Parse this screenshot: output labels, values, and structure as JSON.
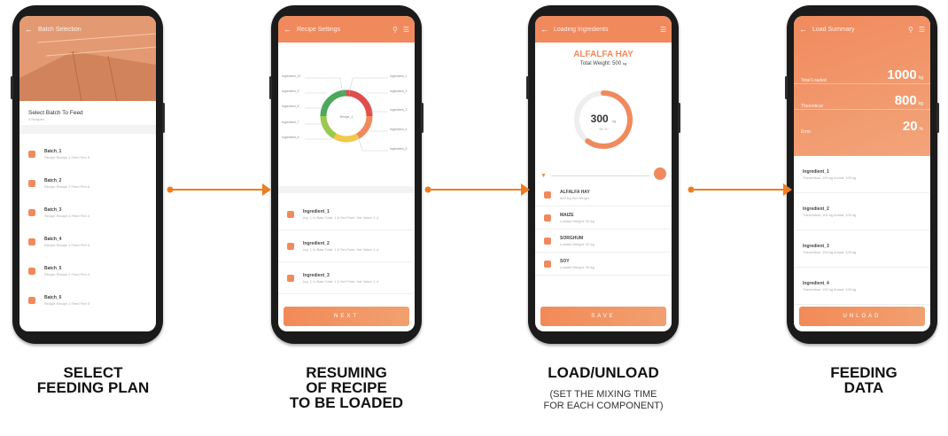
{
  "screens": [
    {
      "title": "Batch Selection",
      "section_title": "Select Batch To Feed",
      "section_sub": "3 Recipes",
      "items": [
        {
          "title": "Batch_1",
          "sub": "Recipe Recipe 1 Feed Pen 9"
        },
        {
          "title": "Batch_2",
          "sub": "Recipe Recipe 2 Feed Pen 8"
        },
        {
          "title": "Batch_3",
          "sub": "Recipe Recipe 3 Feed Pen 4"
        },
        {
          "title": "Batch_4",
          "sub": "Recipe Recipe 1 Feed Pen 4"
        },
        {
          "title": "Batch_5",
          "sub": "Recipe Recipe 2 Feed Pen 3"
        },
        {
          "title": "Batch_6",
          "sub": "Recipe Recipe 1 Feed Pen 5"
        }
      ]
    },
    {
      "title": "Recipe Settings",
      "donut_center": "Recipe_1",
      "donut_labels_left": [
        "Ingredient_10",
        "Ingredient_9",
        "Ingredient_8",
        "Ingredient_7",
        "Ingredient_6"
      ],
      "donut_labels_right": [
        "Ingredient_1",
        "Ingredient_2",
        "Ingredient_3",
        "Ingredient_4",
        "Ingredient_5"
      ],
      "items": [
        {
          "title": "Ingredient_1",
          "sub": "Ing. 1 In Bale Total: 1.6 Set Point: Set Value: 1.4"
        },
        {
          "title": "Ingredient_2",
          "sub": "Ing. 1 In Bale Total: 1.6 Set Point: Set Value: 1.4"
        },
        {
          "title": "Ingredient_3",
          "sub": "Ing. 1 In Bale Total: 1.6 Set Point: Set Value: 1.4"
        }
      ],
      "button": "NEXT"
    },
    {
      "title": "Loading Ingredients",
      "ingredient": "ALFALFA HAY",
      "total_weight_label": "Total Weight:",
      "total_weight_value": "500",
      "total_weight_unit": "kg",
      "gauge_value": "300",
      "gauge_unit": "kg",
      "gauge_sub": "60 %",
      "gauge_progress": 0.6,
      "items": [
        {
          "title": "ALFALFA HAY",
          "sub": "500 Kg Set Weight"
        },
        {
          "title": "MAIZE",
          "sub": "Loaded Weight: 00 kg"
        },
        {
          "title": "SORGHUM",
          "sub": "Loaded Weight: 00 kg"
        },
        {
          "title": "SOY",
          "sub": "Loaded Weight: 00 kg"
        }
      ],
      "button": "SAVE"
    },
    {
      "title": "Load Summary",
      "stats": [
        {
          "label": "Total Loaded",
          "value": "1000",
          "unit": "kg"
        },
        {
          "label": "Theoretical",
          "value": "800",
          "unit": "kg"
        },
        {
          "label": "Error",
          "value": "20",
          "unit": "%"
        }
      ],
      "items": [
        {
          "title": "Ingredient_1",
          "sub": "Theoretical: 100 kg   Actual: 100 kg"
        },
        {
          "title": "Ingredient_2",
          "sub": "Theoretical: 100 kg   Actual: 100 kg"
        },
        {
          "title": "Ingredient_3",
          "sub": "Theoretical: 100 kg   Actual: 100 kg"
        },
        {
          "title": "Ingredient_4",
          "sub": "Theoretical: 100 kg   Actual: 100 kg"
        }
      ],
      "button": "UNLOAD"
    }
  ],
  "captions": [
    {
      "lines": [
        "SELECT",
        "FEEDING PLAN"
      ]
    },
    {
      "lines": [
        "RESUMING",
        "OF RECIPE",
        "TO BE LOADED"
      ]
    },
    {
      "lines": [
        "LOAD/UNLOAD"
      ],
      "sub": [
        "(SET THE MIXING TIME",
        "FOR EACH COMPONENT)"
      ]
    },
    {
      "lines": [
        "FEEDING",
        "DATA"
      ]
    }
  ],
  "colors": {
    "accent": "#f08a5d",
    "arrow": "#ee7d22",
    "frame": "#1b1b1b"
  }
}
